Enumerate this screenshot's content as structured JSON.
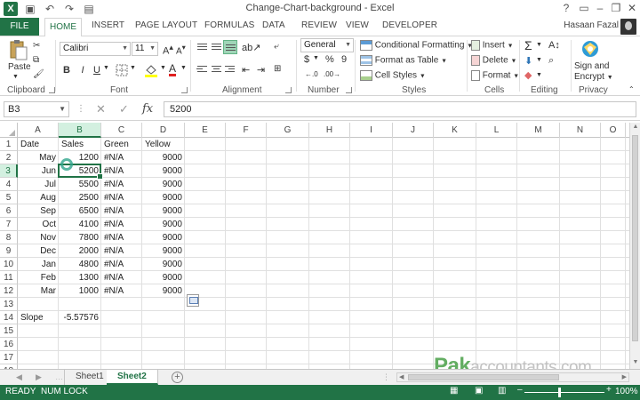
{
  "window": {
    "title": "Change-Chart-background - Excel",
    "user": "Hasaan Fazal",
    "app_icon": "X"
  },
  "tabs": [
    "FILE",
    "HOME",
    "INSERT",
    "PAGE LAYOUT",
    "FORMULAS",
    "DATA",
    "REVIEW",
    "VIEW",
    "DEVELOPER"
  ],
  "ribbon": {
    "clipboard": {
      "paste": "Paste",
      "label": "Clipboard"
    },
    "font": {
      "name": "Calibri",
      "size": "11",
      "label": "Font",
      "bold": "B",
      "italic": "I",
      "underline": "U"
    },
    "alignment": {
      "label": "Alignment"
    },
    "number": {
      "format": "General",
      "currency": "$",
      "percent": "%",
      "comma": "9",
      "label": "Number"
    },
    "styles": {
      "cond": "Conditional Formatting",
      "table": "Format as Table",
      "cell": "Cell Styles",
      "label": "Styles"
    },
    "cells": {
      "insert": "Insert",
      "delete": "Delete",
      "format": "Format",
      "label": "Cells"
    },
    "editing": {
      "label": "Editing"
    },
    "privacy": {
      "sign1": "Sign and",
      "sign2": "Encrypt",
      "label": "Privacy"
    }
  },
  "formula_bar": {
    "name_box": "B3",
    "fx": "fx",
    "value": "5200"
  },
  "columns": [
    "A",
    "B",
    "C",
    "D",
    "E",
    "F",
    "G",
    "H",
    "I",
    "J",
    "K",
    "L",
    "M",
    "N",
    "O"
  ],
  "rows": [
    "1",
    "2",
    "3",
    "4",
    "5",
    "6",
    "7",
    "8",
    "9",
    "10",
    "11",
    "12",
    "13",
    "14",
    "15",
    "16",
    "17",
    "18"
  ],
  "sheet": {
    "headers": [
      "Date",
      "Sales",
      "Green",
      "Yellow"
    ],
    "data": [
      [
        "May",
        "1200",
        "#N/A",
        "9000"
      ],
      [
        "Jun",
        "5200",
        "#N/A",
        "9000"
      ],
      [
        "Jul",
        "5500",
        "#N/A",
        "9000"
      ],
      [
        "Aug",
        "2500",
        "#N/A",
        "9000"
      ],
      [
        "Sep",
        "6500",
        "#N/A",
        "9000"
      ],
      [
        "Oct",
        "4100",
        "#N/A",
        "9000"
      ],
      [
        "Nov",
        "7800",
        "#N/A",
        "9000"
      ],
      [
        "Dec",
        "2000",
        "#N/A",
        "9000"
      ],
      [
        "Jan",
        "4800",
        "#N/A",
        "9000"
      ],
      [
        "Feb",
        "1300",
        "#N/A",
        "9000"
      ],
      [
        "Mar",
        "1000",
        "#N/A",
        "9000"
      ]
    ],
    "slope_label": "Slope",
    "slope_value": "-5.57576"
  },
  "sheet_tabs": [
    "Sheet1",
    "Sheet2"
  ],
  "active_sheet": "Sheet2",
  "watermark": {
    "brand": "Pak",
    "rest": "accountants.com"
  },
  "status": {
    "ready": "READY",
    "numlock": "NUM LOCK",
    "zoom": "100%"
  },
  "colors": {
    "accent": "#217346",
    "selected_header": "#d3f0e0"
  }
}
